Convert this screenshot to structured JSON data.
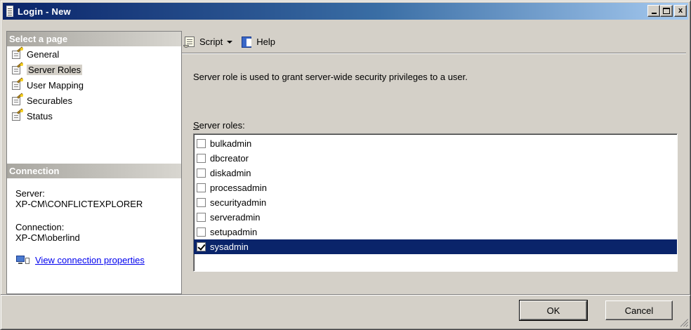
{
  "window": {
    "title": "Login - New"
  },
  "titlebar_buttons": {
    "minimize": "_",
    "maximize": "□",
    "close": "x"
  },
  "left": {
    "select_page_header": "Select a page",
    "pages": [
      {
        "label": "General",
        "icon": "page-wand-icon",
        "selected": false
      },
      {
        "label": "Server Roles",
        "icon": "page-wand-icon",
        "selected": true
      },
      {
        "label": "User Mapping",
        "icon": "page-wand-icon",
        "selected": false
      },
      {
        "label": "Securables",
        "icon": "page-wand-icon",
        "selected": false
      },
      {
        "label": "Status",
        "icon": "page-wand-icon",
        "selected": false
      }
    ],
    "connection_header": "Connection",
    "server_label": "Server:",
    "server_value": "XP-CM\\CONFLICTEXPLORER",
    "connection_label": "Connection:",
    "connection_value": "XP-CM\\oberlind",
    "view_link": "View connection properties"
  },
  "toolbar": {
    "script_label": "Script",
    "help_label": "Help"
  },
  "main": {
    "description": "Server role is used to grant server-wide security privileges to a user.",
    "roles_label_underlined": "S",
    "roles_label_rest": "erver roles:",
    "roles": [
      {
        "name": "bulkadmin",
        "checked": false
      },
      {
        "name": "dbcreator",
        "checked": false
      },
      {
        "name": "diskadmin",
        "checked": false
      },
      {
        "name": "processadmin",
        "checked": false
      },
      {
        "name": "securityadmin",
        "checked": false
      },
      {
        "name": "serveradmin",
        "checked": false
      },
      {
        "name": "setupadmin",
        "checked": false
      },
      {
        "name": "sysadmin",
        "checked": true
      }
    ],
    "selected_role": "sysadmin"
  },
  "footer": {
    "ok_label": "OK",
    "cancel_label": "Cancel"
  },
  "colors": {
    "title_gradient_start": "#0a246a",
    "selection": "#0a246a",
    "link": "#0000ee",
    "face": "#d4d0c8"
  }
}
